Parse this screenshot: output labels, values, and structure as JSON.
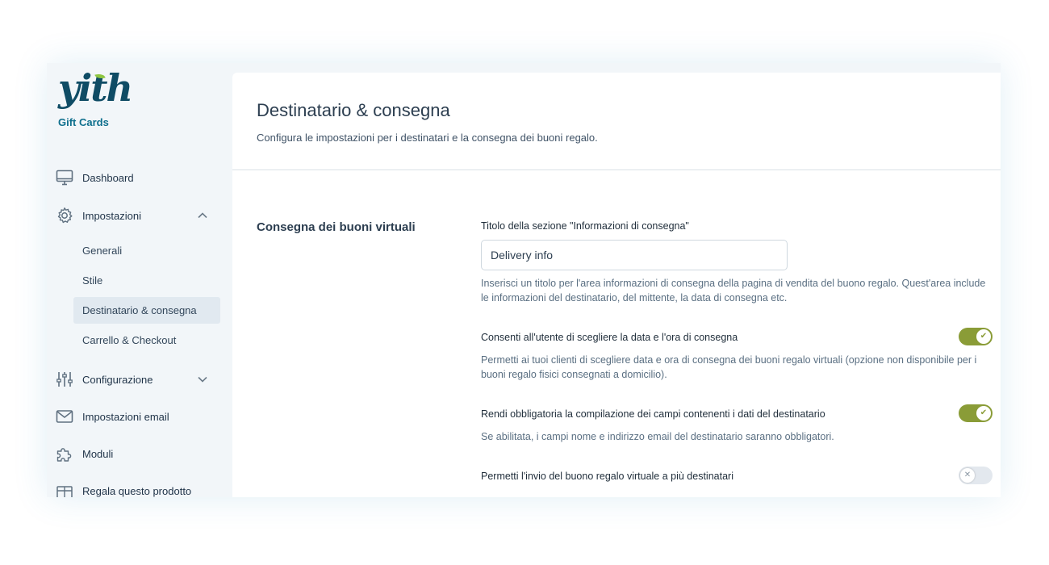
{
  "brand": {
    "logo_text": "yith",
    "product": "Gift Cards"
  },
  "sidebar": {
    "items": [
      {
        "label": "Dashboard",
        "icon": "monitor-icon"
      },
      {
        "label": "Impostazioni",
        "icon": "gear-icon",
        "expanded": true
      },
      {
        "label": "Configurazione",
        "icon": "sliders-icon",
        "expanded": false
      },
      {
        "label": "Impostazioni email",
        "icon": "envelope-icon"
      },
      {
        "label": "Moduli",
        "icon": "puzzle-icon"
      },
      {
        "label": "Regala questo prodotto",
        "icon": "gift-icon"
      }
    ],
    "subitems": [
      {
        "label": "Generali"
      },
      {
        "label": "Stile"
      },
      {
        "label": "Destinatario & consegna",
        "active": true
      },
      {
        "label": "Carrello & Checkout"
      }
    ]
  },
  "page": {
    "title": "Destinatario & consegna",
    "subtitle": "Configura le impostazioni per i destinatari e la consegna dei buoni regalo."
  },
  "section": {
    "title": "Consegna dei buoni virtuali",
    "options": [
      {
        "label": "Titolo della sezione \"Informazioni di consegna\"",
        "value": "Delivery info",
        "desc": "Inserisci un titolo per l'area informazioni di consegna della pagina di vendita del buono regalo. Quest'area include le informazioni del destinatario, del mittente, la data di consegna etc."
      },
      {
        "label": "Consenti all'utente di scegliere la data e l'ora di consegna",
        "enabled": true,
        "desc": "Permetti ai tuoi clienti di scegliere data e ora di consegna dei buoni regalo virtuali (opzione non disponibile per i buoni regalo fisici consegnati a domicilio)."
      },
      {
        "label": "Rendi obbligatoria la compilazione dei campi contenenti i dati del destinatario",
        "enabled": true,
        "desc": "Se abilitata, i campi nome e indirizzo email del destinatario saranno obbligatori."
      },
      {
        "label": "Permetti l'invio del buono regalo virtuale a più destinatari",
        "enabled": false
      }
    ]
  },
  "colors": {
    "accent": "#8a9c37",
    "brand": "#0f4c65",
    "sidebar_bg": "#f2f6f9",
    "active_bg": "#e1e9f0"
  }
}
